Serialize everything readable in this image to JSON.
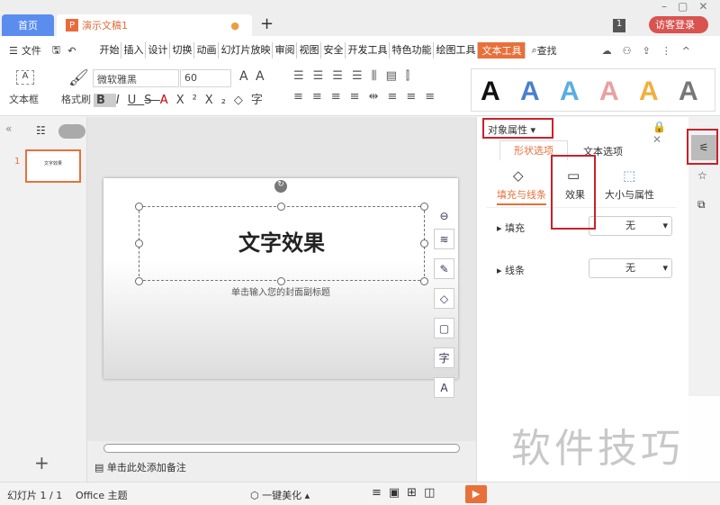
{
  "tabs": {
    "home": "首页",
    "doc": "演示文稿1",
    "new": "+"
  },
  "titlebar": {
    "count": "1",
    "login": "访客登录"
  },
  "menu": {
    "file": "文件",
    "items": [
      "开始",
      "插入",
      "设计",
      "切换",
      "动画",
      "幻灯片放映",
      "审阅",
      "视图",
      "安全",
      "开发工具",
      "特色功能",
      "绘图工具",
      "文本工具"
    ],
    "active": "文本工具",
    "search": "查找"
  },
  "ribbon": {
    "textbox": "文本框",
    "format_painter": "格式刷",
    "font": "微软雅黑",
    "size": "60",
    "styles": [
      "A",
      "A",
      "A",
      "A",
      "A",
      "A"
    ],
    "style_colors": [
      "#111111",
      "#4a7fd0",
      "#5aaee0",
      "#e8a0a0",
      "#f0b040",
      "#777777"
    ]
  },
  "slides": {
    "number": "1",
    "thumb_text": "文字效果"
  },
  "slide": {
    "title": "文字效果",
    "subtitle": "单击输入您的封面副标题"
  },
  "float_buttons": [
    "⊖",
    "≋",
    "✎",
    "◇",
    "▢",
    "字",
    "A"
  ],
  "notes": "单击此处添加备注",
  "add_slide": "+",
  "panel": {
    "title": "对象属性",
    "tabs": [
      "形状选项",
      "文本选项"
    ],
    "subtabs": [
      "填充与线条",
      "效果",
      "大小与属性"
    ],
    "rows": [
      {
        "label": "填充",
        "value": "无"
      },
      {
        "label": "线条",
        "value": "无"
      }
    ]
  },
  "status": {
    "slide": "幻灯片 1 / 1",
    "theme": "Office 主题",
    "beautify": "一键美化"
  },
  "watermark": "软件技巧",
  "colors": {
    "accent": "#e8703a",
    "highlight": "#c8222b",
    "tab_blue": "#5b8def"
  }
}
